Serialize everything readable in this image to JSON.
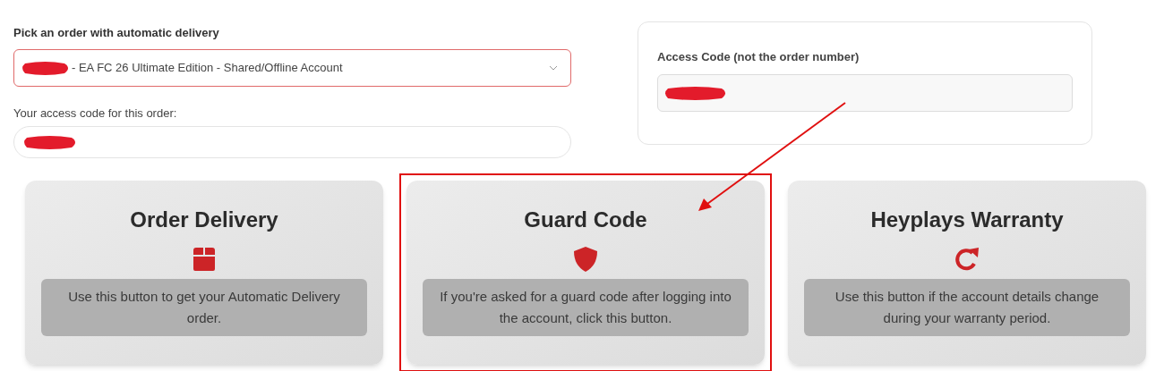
{
  "order_picker": {
    "label": "Pick an order with automatic delivery",
    "value": "- EA FC 26 Ultimate Edition - Shared/Offline Account",
    "redacted": true
  },
  "access_code": {
    "label": "Your access code for this order:",
    "redacted": true
  },
  "access_code_card": {
    "label": "Access Code (not the order number)",
    "redacted": true
  },
  "cards": [
    {
      "kind": "box",
      "title": "Order Delivery",
      "description": "Use this button to get your Automatic Delivery order.",
      "highlighted": false
    },
    {
      "kind": "shield",
      "title": "Guard Code",
      "description": "If you're asked for a guard code after logging into the account, click this button.",
      "highlighted": true
    },
    {
      "kind": "refresh",
      "title": "Heyplays Warranty",
      "description": "Use this button if the account details change during your warranty period.",
      "highlighted": false
    }
  ],
  "annotation_arrow": true
}
